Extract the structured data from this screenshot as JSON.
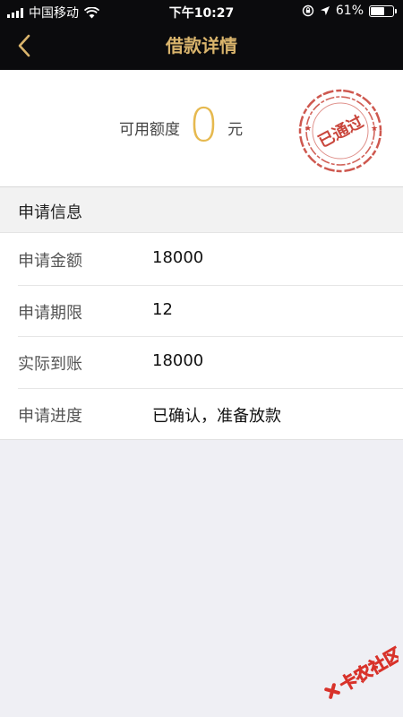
{
  "status_bar": {
    "carrier": "中国移动",
    "time": "下午10:27",
    "battery": "61%",
    "battery_level": 0.61
  },
  "nav": {
    "title": "借款详情"
  },
  "credit": {
    "label": "可用额度",
    "value": "0",
    "unit": "元"
  },
  "stamp": {
    "text": "已通过",
    "color": "#c9463c"
  },
  "section": {
    "title": "申请信息"
  },
  "rows": [
    {
      "label": "申请金额",
      "value": "18000"
    },
    {
      "label": "申请期限",
      "value": "12"
    },
    {
      "label": "实际到账",
      "value": "18000"
    },
    {
      "label": "申请进度",
      "value": "已确认，准备放款"
    }
  ],
  "watermark": {
    "text": "卡农社区"
  },
  "colors": {
    "accent": "#d9b46c",
    "credit_value": "#e6b94f",
    "header_bg": "#0b0b0d"
  }
}
